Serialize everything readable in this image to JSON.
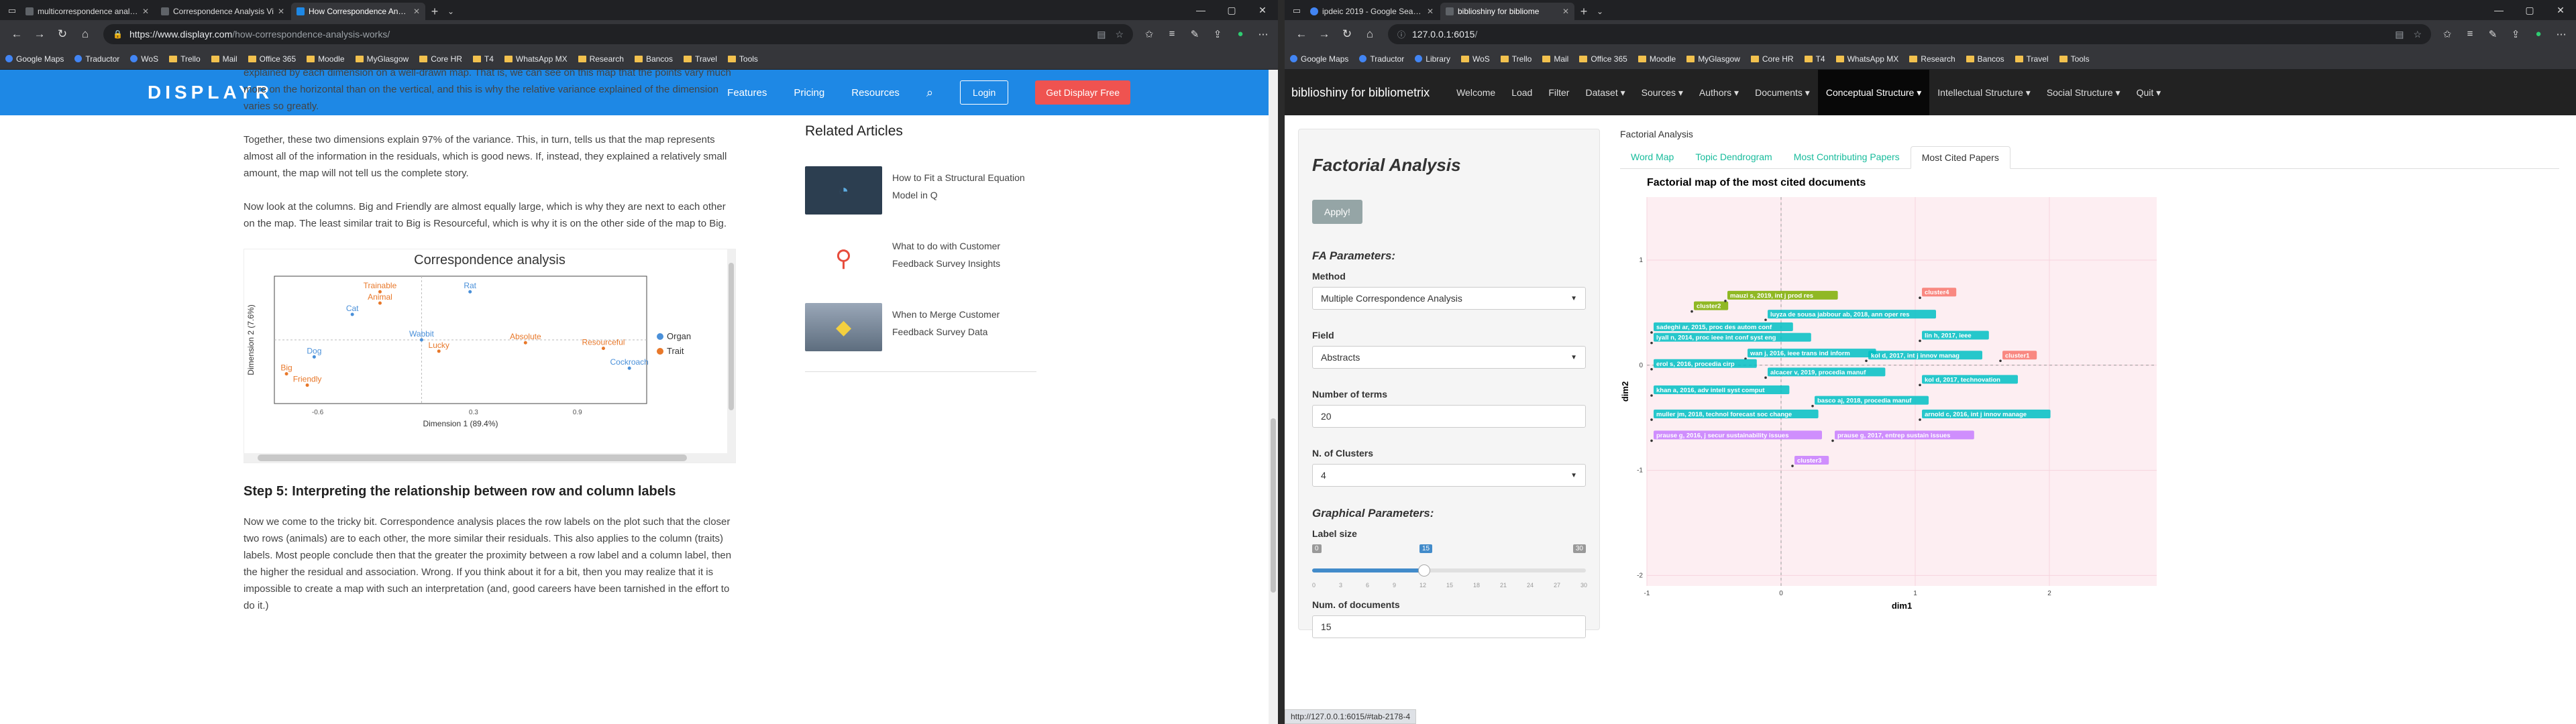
{
  "left": {
    "tabs": [
      {
        "title": "multicorrespondence analysi"
      },
      {
        "title": "Correspondence Analysis Vi"
      },
      {
        "title": "How Correspondence Analysi",
        "active": true
      }
    ],
    "url": {
      "host": "https://www.displayr.com",
      "path": "/how-correspondence-analysis-works/"
    },
    "bookmarks": [
      "Google Maps",
      "Traductor",
      "WoS",
      "Trello",
      "Mail",
      "Office 365",
      "Moodle",
      "MyGlasgow",
      "Core HR",
      "T4",
      "WhatsApp MX",
      "Research",
      "Bancos",
      "Travel",
      "Tools"
    ],
    "site": {
      "logo": "DISPLAYR",
      "menu": [
        "Features",
        "Pricing",
        "Resources"
      ],
      "login": "Login",
      "cta": "Get Displayr Free"
    },
    "article": {
      "p1": "explained by each dimension on a well-drawn map. That is, we can see on this map that the points vary much more on the horizontal than on the vertical, and this is why the relative variance explained of the dimension varies so greatly.",
      "p2": "Together, these two dimensions explain 97% of the variance.  This, in turn, tells us that the map represents almost all of the information in the residuals, which is good news. If, instead, they explained a relatively small amount, the map will not tell us the complete story.",
      "p3": "Now look at the columns. Big and Friendly are almost equally large, which is why they are next to each other on the map. The least similar trait to Big is Resourceful, which is why it is on the other side of the map to Big.",
      "chart_title": "Correspondence analysis",
      "h3": "Step 5: Interpreting the relationship between row and column labels",
      "p4": "Now we come to the tricky bit. Correspondence analysis places the row labels on the plot such that the closer two rows (animals) are to each other, the more similar their residuals. This also applies to the column (traits) labels. Most people conclude then that the greater the proximity between a row label and a column label, then the higher the residual and association. Wrong. If you think about it for a bit, then you may realize that it is impossible to create a map with such an interpretation (and, good careers have been tarnished in the effort to do it.)"
    },
    "related": {
      "heading": "Related Articles",
      "items": [
        "How to Fit a Structural Equation Model in Q",
        "What to do with Customer Feedback Survey Insights",
        "When to Merge Customer Feedback Survey Data"
      ]
    }
  },
  "right": {
    "tabs": [
      {
        "title": "ipdeic 2019 - Google Search"
      },
      {
        "title": "biblioshiny for bibliome",
        "active": true
      }
    ],
    "url": {
      "host": "127.0.0.1:6015",
      "path": "/"
    },
    "bookmarks": [
      "Google Maps",
      "Traductor",
      "Library",
      "WoS",
      "Trello",
      "Mail",
      "Office 365",
      "Moodle",
      "MyGlasgow",
      "Core HR",
      "T4",
      "WhatsApp MX",
      "Research",
      "Bancos",
      "Travel",
      "Tools"
    ],
    "app": {
      "brand": "biblioshiny for bibliometrix",
      "menu": [
        "Welcome",
        "Load",
        "Filter",
        "Dataset ▾",
        "Sources ▾",
        "Authors ▾",
        "Documents ▾",
        "Conceptual Structure ▾",
        "Intellectual Structure ▾",
        "Social Structure ▾",
        "Quit ▾"
      ],
      "active_menu": 7
    },
    "panel": {
      "title": "Factorial Analysis",
      "apply": "Apply!",
      "fa_params": "FA Parameters:",
      "method_label": "Method",
      "method_value": "Multiple Correspondence Analysis",
      "field_label": "Field",
      "field_value": "Abstracts",
      "terms_label": "Number of terms",
      "terms_value": "20",
      "clusters_label": "N. of Clusters",
      "clusters_value": "4",
      "graph_params": "Graphical Parameters:",
      "labelsize_label": "Label size",
      "labelsize_min": "0",
      "labelsize_max": "30",
      "labelsize_value": "15",
      "labelsize_ticks": [
        "0",
        "3",
        "6",
        "9",
        "12",
        "15",
        "18",
        "21",
        "24",
        "27",
        "30"
      ],
      "docs_label": "Num. of documents",
      "docs_value": "15"
    },
    "breadcrumb": "Factorial Analysis",
    "subtabs": [
      "Word Map",
      "Topic Dendrogram",
      "Most Contributing Papers",
      "Most Cited Papers"
    ],
    "active_subtab": 3,
    "plot_title": "Factorial map of the most cited documents",
    "status": "http://127.0.0.1:6015/#tab-2178-4"
  },
  "chart_data": [
    {
      "type": "scatter",
      "title": "Correspondence analysis",
      "xlabel": "Dimension 1 (89.4%)",
      "ylabel": "Dimension 2 (7.6%)",
      "xticks": [
        "-0.6",
        "0.3",
        "0.9"
      ],
      "legend": [
        "Organ",
        "Trait"
      ],
      "colors": {
        "Organ": "#4a90d9",
        "Trait": "#e8782a"
      },
      "series": [
        {
          "name": "Organ",
          "points": [
            {
              "label": "Rat",
              "x": 0.28,
              "y": 0.34
            },
            {
              "label": "Cat",
              "x": -0.4,
              "y": 0.18
            },
            {
              "label": "Dog",
              "x": -0.62,
              "y": -0.12
            },
            {
              "label": "Cockroach",
              "x": 1.2,
              "y": -0.2
            },
            {
              "label": "Wabbit",
              "x": 0.0,
              "y": 0.0
            }
          ]
        },
        {
          "name": "Trait",
          "points": [
            {
              "label": "Trainable",
              "x": -0.24,
              "y": 0.34
            },
            {
              "label": "Animal",
              "x": -0.24,
              "y": 0.26
            },
            {
              "label": "Lucky",
              "x": 0.1,
              "y": -0.08
            },
            {
              "label": "Absolute",
              "x": 0.6,
              "y": -0.02
            },
            {
              "label": "Resourceful",
              "x": 1.05,
              "y": -0.06
            },
            {
              "label": "Big",
              "x": -0.78,
              "y": -0.24
            },
            {
              "label": "Friendly",
              "x": -0.66,
              "y": -0.32
            }
          ]
        }
      ],
      "xlim": [
        -0.85,
        1.3
      ],
      "ylim": [
        -0.45,
        0.45
      ]
    },
    {
      "type": "scatter",
      "title": "Factorial map of the most cited documents",
      "xlabel": "dim1",
      "ylabel": "dim2",
      "xlim": [
        -1,
        2.8
      ],
      "ylim": [
        -2.1,
        1.6
      ],
      "xticks": [
        -1,
        0,
        1,
        2
      ],
      "yticks": [
        -2,
        -1,
        0,
        1
      ],
      "clusters": [
        {
          "name": "cluster1",
          "color": "#f8766d"
        },
        {
          "name": "cluster2",
          "color": "#7cae00"
        },
        {
          "name": "cluster3",
          "color": "#00bfc4"
        },
        {
          "name": "cluster4",
          "color": "#c77cff"
        }
      ],
      "labels": [
        {
          "text": "cluster2",
          "x": -0.65,
          "y": 0.55,
          "cluster": 1
        },
        {
          "text": "mauzi s, 2019, int j prod res",
          "x": -0.4,
          "y": 0.65,
          "cluster": 1
        },
        {
          "text": "cluster4",
          "x": 1.05,
          "y": 0.68,
          "cluster": 0
        },
        {
          "text": "luyza de sousa jabbour ab, 2018, ann oper res",
          "x": -0.1,
          "y": 0.47,
          "cluster": 2
        },
        {
          "text": "sadeghi ar, 2015, proc des autom conf",
          "x": -0.95,
          "y": 0.35,
          "cluster": 2
        },
        {
          "text": "lin h, 2017, ieee",
          "x": 1.05,
          "y": 0.27,
          "cluster": 2
        },
        {
          "text": "lyall n, 2014, proc ieee int conf syst eng",
          "x": -0.95,
          "y": 0.25,
          "cluster": 2
        },
        {
          "text": "wan j, 2016, ieee trans ind inform",
          "x": -0.25,
          "y": 0.1,
          "cluster": 2
        },
        {
          "text": "kol d, 2017, int j innov manag",
          "x": 0.65,
          "y": 0.08,
          "cluster": 2
        },
        {
          "text": "cluster1",
          "x": 1.65,
          "y": 0.08,
          "cluster": 0
        },
        {
          "text": "erol s, 2016, procedia cirp",
          "x": -0.95,
          "y": 0.0,
          "cluster": 2
        },
        {
          "text": "alcacer v, 2019, procedia manuf",
          "x": -0.1,
          "y": -0.08,
          "cluster": 2
        },
        {
          "text": "kol d, 2017, technovation",
          "x": 1.05,
          "y": -0.15,
          "cluster": 2
        },
        {
          "text": "khan a, 2016, adv intell syst comput",
          "x": -0.95,
          "y": -0.25,
          "cluster": 2
        },
        {
          "text": "basco aj, 2018, procedia manuf",
          "x": 0.25,
          "y": -0.35,
          "cluster": 2
        },
        {
          "text": "muller jm, 2018, technol forecast soc change",
          "x": -0.95,
          "y": -0.48,
          "cluster": 2
        },
        {
          "text": "arnold c, 2016, int j innov manage",
          "x": 1.05,
          "y": -0.48,
          "cluster": 2
        },
        {
          "text": "prause g, 2016, j secur sustainability issues",
          "x": -0.95,
          "y": -0.68,
          "cluster": 3
        },
        {
          "text": "prause g, 2017, entrep sustain issues",
          "x": 0.4,
          "y": -0.68,
          "cluster": 3
        },
        {
          "text": "cluster3",
          "x": 0.1,
          "y": -0.92,
          "cluster": 3
        }
      ]
    }
  ]
}
